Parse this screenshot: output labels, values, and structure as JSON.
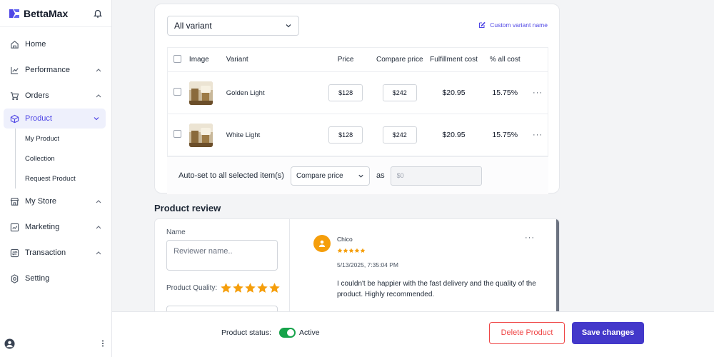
{
  "brand": {
    "name": "BettaMax"
  },
  "sidebar": {
    "items": [
      {
        "label": "Home",
        "icon": "home-icon"
      },
      {
        "label": "Performance",
        "icon": "chart-icon"
      },
      {
        "label": "Orders",
        "icon": "cart-icon"
      },
      {
        "label": "Product",
        "icon": "box-icon",
        "active": true
      },
      {
        "label": "My Store",
        "icon": "store-icon"
      },
      {
        "label": "Marketing",
        "icon": "marketing-icon"
      },
      {
        "label": "Transaction",
        "icon": "transaction-icon"
      },
      {
        "label": "Setting",
        "icon": "gear-icon"
      }
    ],
    "product_sub": [
      "My Product",
      "Collection",
      "Request Product"
    ]
  },
  "variants": {
    "selector_value": "All variant",
    "custom_name_link": "Custom variant name",
    "columns": {
      "image": "Image",
      "variant": "Variant",
      "price": "Price",
      "compare_price": "Compare price",
      "fulfillment_cost": "Fulfillment cost",
      "pct_all_cost": "% all cost"
    },
    "rows": [
      {
        "name": "Golden Light",
        "price": "$128",
        "compare_price": "$242",
        "fulfillment_cost": "$20.95",
        "pct": "15.75%"
      },
      {
        "name": "White Light",
        "price": "$128",
        "compare_price": "$242",
        "fulfillment_cost": "$20.95",
        "pct": "15.75%"
      }
    ],
    "autoset": {
      "label": "Auto-set to all selected item(s)",
      "field": "Compare price",
      "as": "as",
      "value_placeholder": "$0"
    }
  },
  "review": {
    "title": "Product review",
    "name_label": "Name",
    "name_placeholder": "Reviewer name..",
    "quality_label": "Product Quality:",
    "quality_rating": 5,
    "items": [
      {
        "author": "Chico",
        "rating": 5,
        "date": "5/13/2025, 7:35:04 PM",
        "text": "I couldn't be happier with the fast delivery and the quality of the product. Highly recommended."
      }
    ]
  },
  "bottom": {
    "status_label": "Product status:",
    "status_value": "Active",
    "delete_label": "Delete Product",
    "save_label": "Save changes"
  },
  "colors": {
    "accent": "#4f46e5",
    "primary_button": "#4338ca",
    "danger": "#ef4444",
    "toggle_on": "#16a34a",
    "star": "#f59e0b"
  }
}
